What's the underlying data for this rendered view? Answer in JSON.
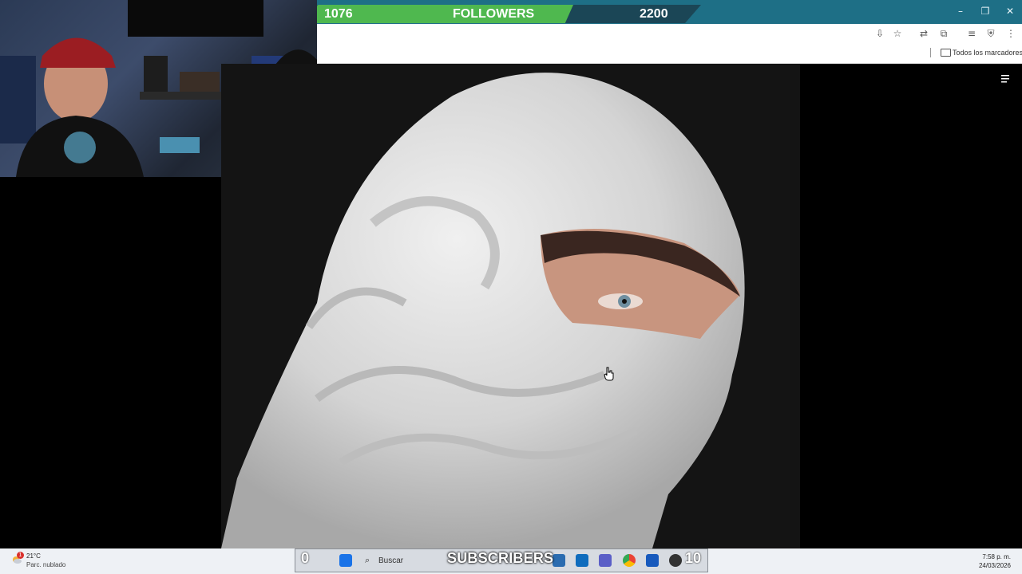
{
  "stream_overlay": {
    "followers_current": "1076",
    "followers_label": "FOLLOWERS",
    "followers_goal": "2200",
    "subscribers_current": "0",
    "subscribers_label": "SUBSCRIBERS",
    "subscribers_goal": "10"
  },
  "browser": {
    "bookmarks_label": "Todos los marcadores"
  },
  "taskbar": {
    "weather_temp": "21°C",
    "weather_desc": "Parc. nublado",
    "weather_badge": "1",
    "search_placeholder": "Buscar",
    "clock_time": "7:58 p. m.",
    "clock_date": "24/03/2026"
  },
  "colors": {
    "titlebar": "#1e6f86",
    "followers_green": "#4fb84f",
    "followers_dark": "#1b4656"
  }
}
